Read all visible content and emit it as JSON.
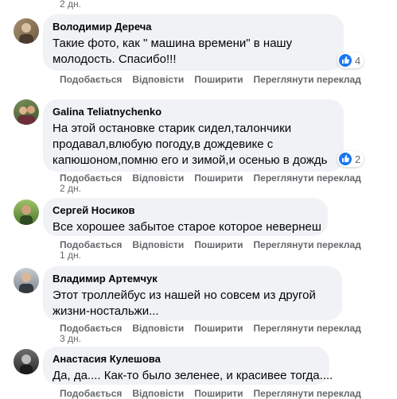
{
  "top_time": "2 дн.",
  "actions": {
    "like": "Подобається",
    "reply": "Відповісти",
    "share": "Поширити",
    "translate": "Переглянути переклад"
  },
  "comments": [
    {
      "author": "Володимир Дереча",
      "lines": [
        "Такие фото, как \" машина времени\" в нашу",
        "молодость. Спасибо!!!"
      ],
      "reactions": "4",
      "time": ""
    },
    {
      "author": "Galina Teliatnychenko",
      "lines": [
        "На этой остановке старик сидел,талончики",
        "продавал,влюбую погоду,в дождевике с",
        "капюшоном,помню его и зимой,и осенью в дождь"
      ],
      "reactions": "2",
      "time": "2 дн."
    },
    {
      "author": "Сергей Носиков",
      "lines": [
        "Все хорошее забытое старое которое невернеш"
      ],
      "reactions": "",
      "time": "1 дн."
    },
    {
      "author": "Владимир Артемчук",
      "lines": [
        "Этот троллейбус из нашей но совсем из другой",
        "жизни-ностальжи..."
      ],
      "reactions": "",
      "time": "3 дн."
    },
    {
      "author": "Анастасия Кулешова",
      "lines": [
        "Да, да.... Как-то было зеленее, и красивее тогда...."
      ],
      "reactions": "",
      "time": ""
    }
  ],
  "colors": {
    "bubble": "#f0f2f5",
    "meta": "#65676b",
    "like": "#1877f2"
  }
}
